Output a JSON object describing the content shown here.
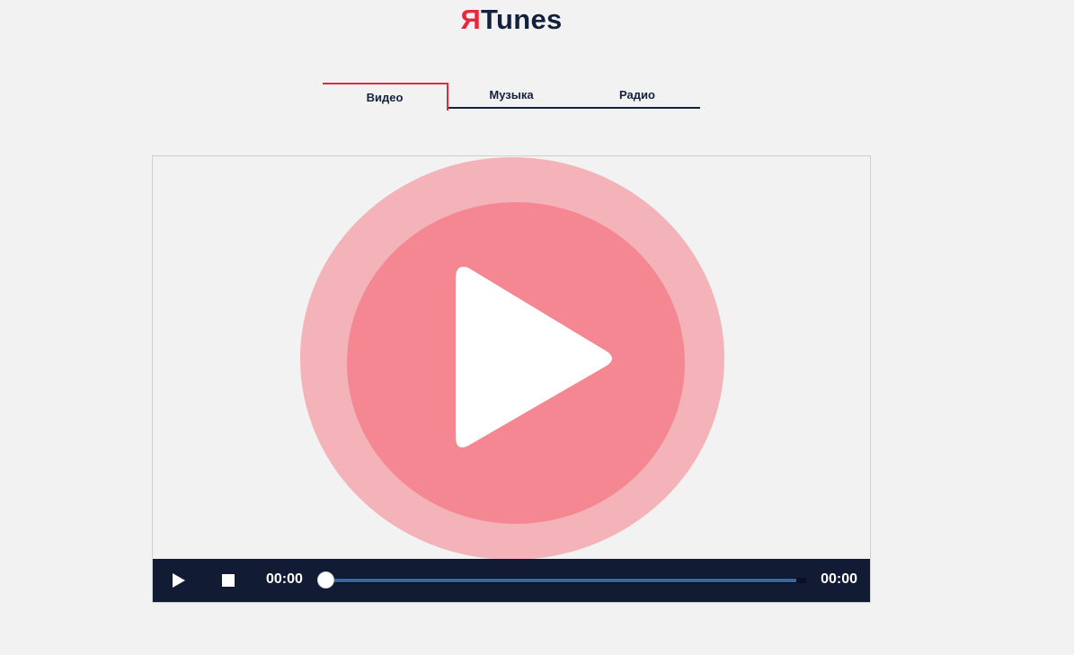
{
  "logo": {
    "mark": "Я",
    "name": "Tunes"
  },
  "tabs": [
    {
      "label": "Видео",
      "active": true
    },
    {
      "label": "Музыка",
      "active": false
    },
    {
      "label": "Радио",
      "active": false
    }
  ],
  "player": {
    "current_time": "00:00",
    "total_time": "00:00",
    "progress": 0.98,
    "icons": {
      "poster": "big-play-icon",
      "play": "play-icon",
      "stop": "stop-icon"
    }
  },
  "colors": {
    "accent": "#e5293b",
    "text": "#14213d",
    "control_bar": "#111b33",
    "progress_fill": "#3467a6",
    "poster_outer": "#f3b3b8",
    "poster_inner": "#f48792",
    "background": "#f2f2f2"
  }
}
